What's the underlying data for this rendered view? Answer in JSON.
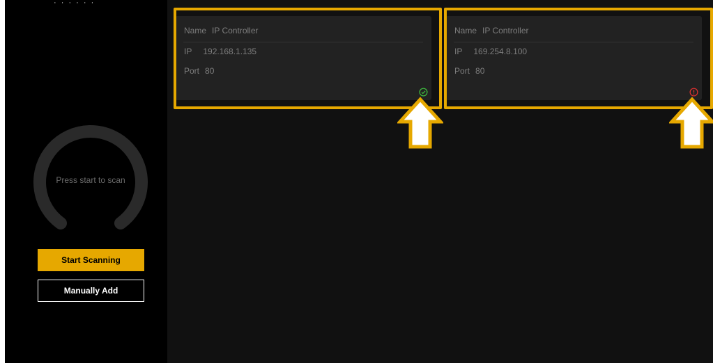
{
  "window": {
    "title_fragment": "·  ·  ·  · ·  ·"
  },
  "scanner": {
    "status_text": "Press start to scan",
    "start_label": "Start Scanning",
    "manual_label": "Manually Add"
  },
  "devices": [
    {
      "name_label": "Name",
      "name": "IP Controller",
      "ip_label": "IP",
      "ip": "192.168.1.135",
      "port_label": "Port",
      "port": "80",
      "status": "connected",
      "status_icon": "check-circle-icon",
      "status_color": "#3fbf3f"
    },
    {
      "name_label": "Name",
      "name": "IP Controller",
      "ip_label": "IP",
      "ip": "169.254.8.100",
      "port_label": "Port",
      "port": "80",
      "status": "error",
      "status_icon": "alert-circle-icon",
      "status_color": "#e03030"
    }
  ],
  "colors": {
    "accent": "#e6a800",
    "card_bg": "#222222",
    "sidebar_bg": "#000000",
    "content_bg": "#111111"
  }
}
